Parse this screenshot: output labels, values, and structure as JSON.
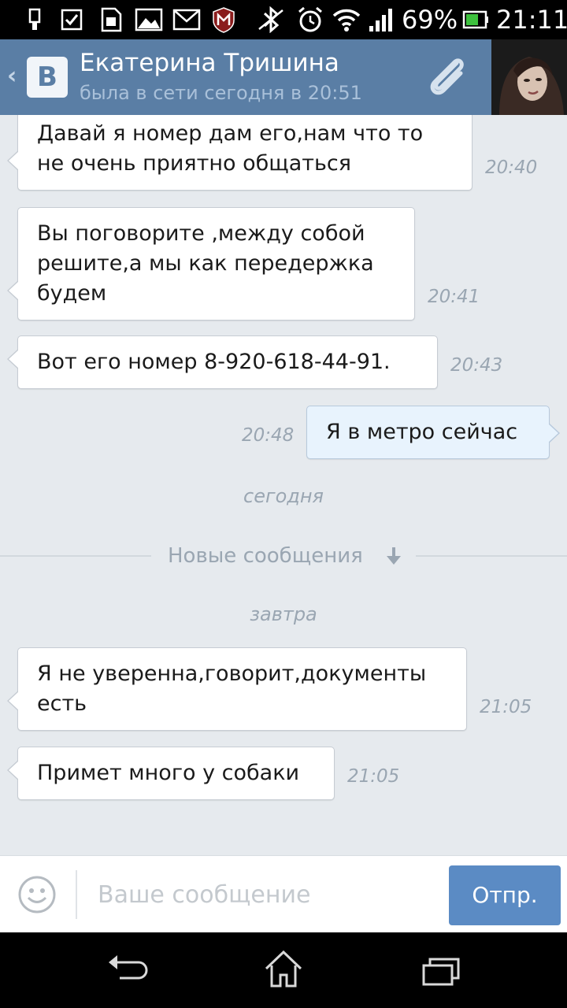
{
  "status_bar": {
    "battery_percent": "69%",
    "time": "21:11",
    "icons": [
      "usb-icon",
      "checkbox-icon",
      "sim-icon",
      "image-icon",
      "mail-icon",
      "mcafee-icon",
      "bluetooth-icon",
      "alarm-icon",
      "wifi-icon",
      "signal-icon",
      "battery-icon"
    ]
  },
  "header": {
    "name": "Екатерина Тришина",
    "status": "была в сети сегодня в 20:51",
    "logo_letter": "В"
  },
  "messages": [
    {
      "direction": "in",
      "lines": [
        "Давай я номер дам его,нам что то",
        "не очень приятно общаться"
      ],
      "time": "20:40"
    },
    {
      "direction": "in",
      "lines": [
        "Вы поговорите ,между собой",
        "решите,а мы как передержка",
        "будем"
      ],
      "time": "20:41"
    },
    {
      "direction": "in",
      "lines": [
        "Вот его номер 8-920-618-44-91."
      ],
      "time": "20:43"
    },
    {
      "direction": "out",
      "lines": [
        "Я в метро сейчас"
      ],
      "time": "20:48"
    },
    {
      "direction": "in",
      "lines": [
        "Я не уверенна,говорит,документы",
        "есть"
      ],
      "time": "21:05"
    },
    {
      "direction": "in",
      "lines": [
        "Примет много у собаки"
      ],
      "time": "21:05"
    }
  ],
  "day_labels": {
    "today": "сегодня",
    "tomorrow": "завтра"
  },
  "new_messages_label": "Новые сообщения",
  "input": {
    "placeholder": "Ваше сообщение",
    "value": "",
    "send_label": "Отпр."
  },
  "colors": {
    "header_bg": "#5a7ea5",
    "send_button": "#5b8bc4",
    "chat_bg": "#e6eaee",
    "outgoing_bubble": "#e8f3fd"
  }
}
